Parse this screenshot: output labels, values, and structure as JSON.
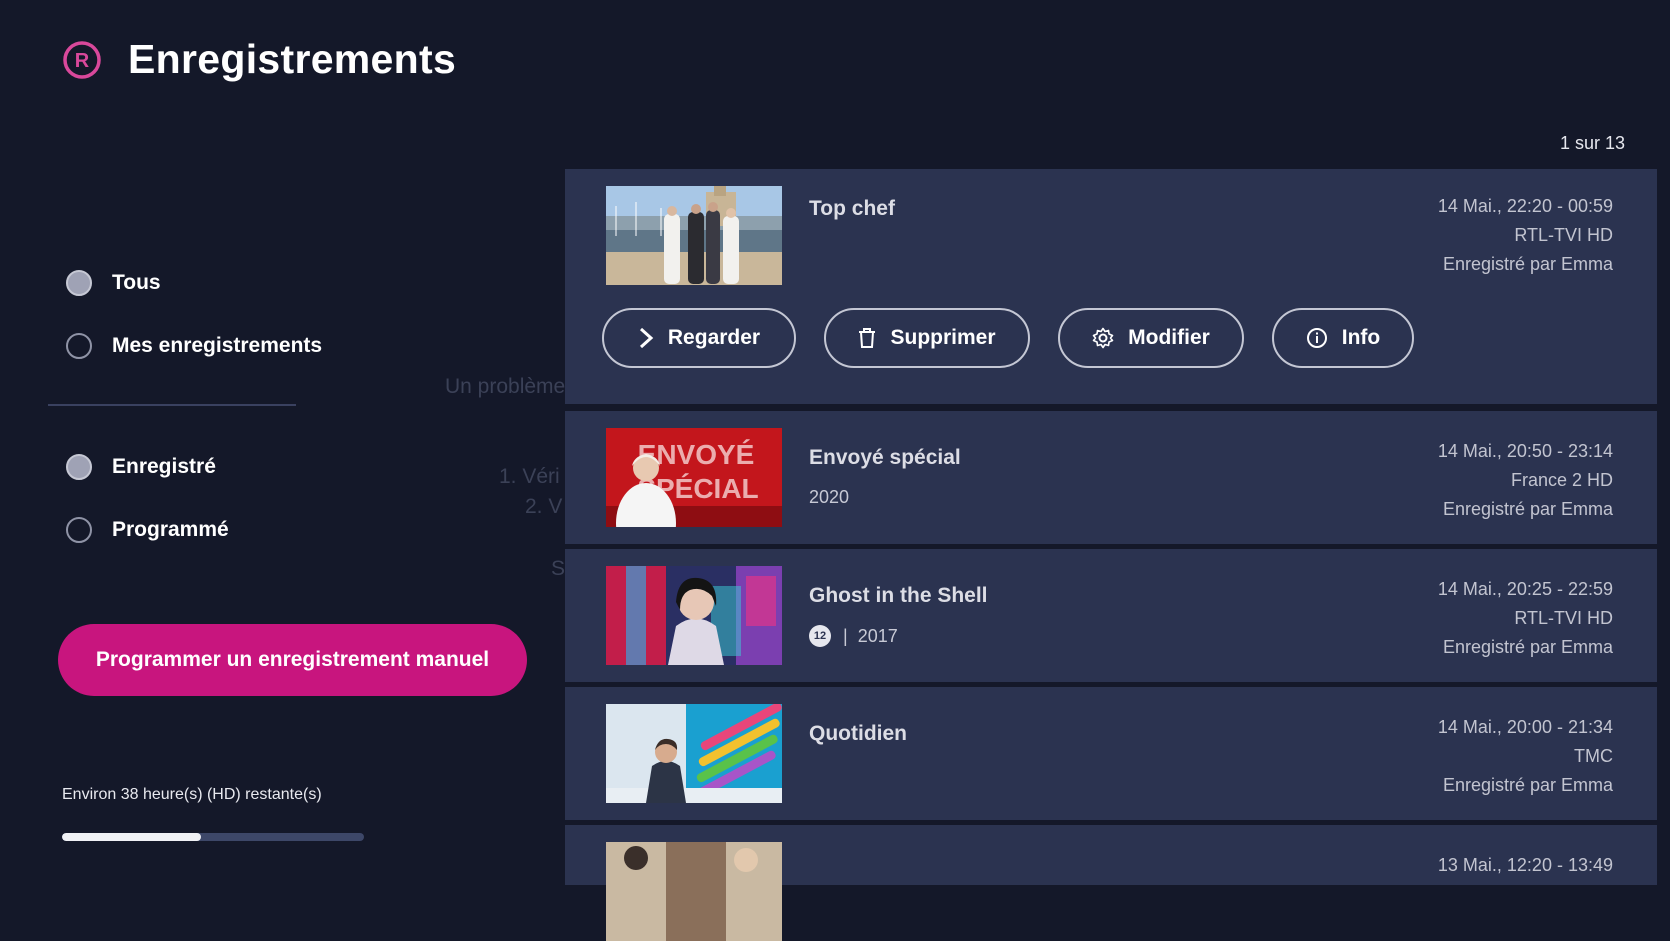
{
  "header": {
    "title": "Enregistrements",
    "icon": "registered-icon"
  },
  "filters": {
    "owner": [
      {
        "label": "Tous",
        "selected": true
      },
      {
        "label": "Mes enregistrements",
        "selected": false
      }
    ],
    "status": [
      {
        "label": "Enregistré",
        "selected": true
      },
      {
        "label": "Programmé",
        "selected": false
      }
    ]
  },
  "manual_button": {
    "label": "Programmer un enregistrement manuel"
  },
  "storage": {
    "text": "Environ 38 heure(s) (HD) restante(s)",
    "used_fraction": 0.46
  },
  "pagination": {
    "text": "1 sur 13"
  },
  "background_message": {
    "line1": "Un problème",
    "line2": "1. Véri",
    "line3": "2. V",
    "line4": "S"
  },
  "actions": [
    {
      "label": "Regarder",
      "icon": "chevron-right-icon"
    },
    {
      "label": "Supprimer",
      "icon": "trash-icon"
    },
    {
      "label": "Modifier",
      "icon": "gear-icon"
    },
    {
      "label": "Info",
      "icon": "info-icon"
    }
  ],
  "recordings": [
    {
      "title": "Top chef",
      "subtitle": "",
      "datetime": "14 Mai., 22:20 - 00:59",
      "channel": "RTL-TVI HD",
      "recorded_by": "Enregistré par Emma",
      "expanded": true
    },
    {
      "title": "Envoyé spécial",
      "subtitle": "2020",
      "datetime": "14 Mai., 20:50 - 23:14",
      "channel": "France 2 HD",
      "recorded_by": "Enregistré par Emma",
      "thumb_text": "ENVOYÉ SPÉCIAL"
    },
    {
      "title": "Ghost in the Shell",
      "age_rating": "12",
      "subtitle": "2017",
      "datetime": "14 Mai., 20:25 - 22:59",
      "channel": "RTL-TVI HD",
      "recorded_by": "Enregistré par Emma"
    },
    {
      "title": "Quotidien",
      "subtitle": "",
      "datetime": "14 Mai., 20:00 - 21:34",
      "channel": "TMC",
      "recorded_by": "Enregistré par Emma"
    },
    {
      "title": "",
      "subtitle": "",
      "datetime": "13 Mai., 12:20 - 13:49",
      "channel": "",
      "recorded_by": ""
    }
  ],
  "colors": {
    "background": "#141829",
    "card": "#2b3350",
    "accent": "#c8157e"
  }
}
